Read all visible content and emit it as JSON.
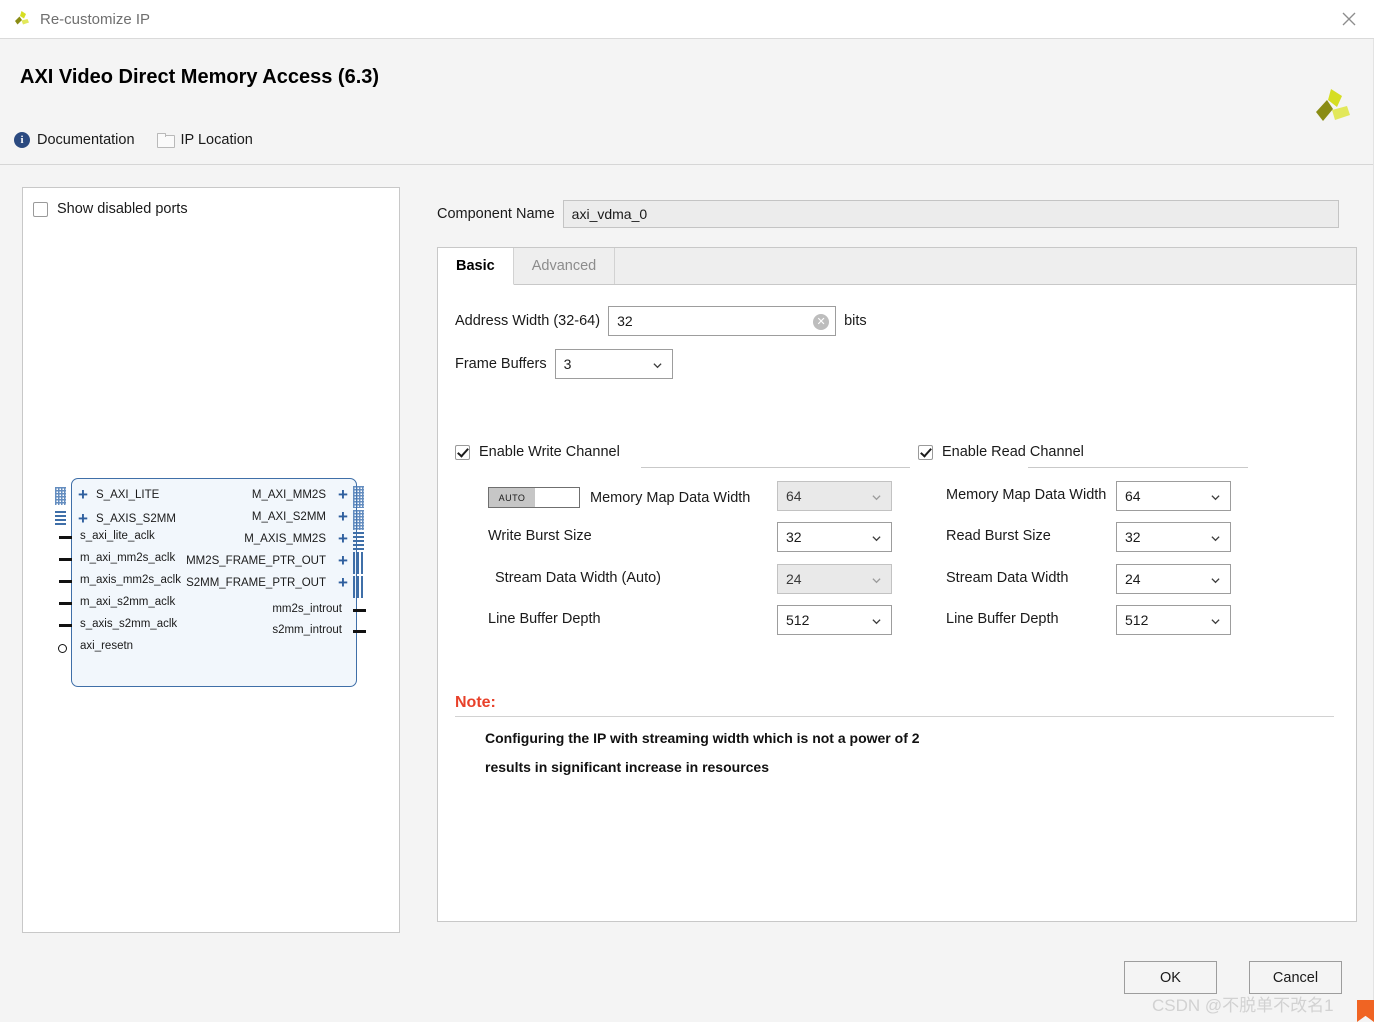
{
  "window": {
    "title": "Re-customize IP",
    "close_icon": "close-icon",
    "app_logo": "xilinx-logo"
  },
  "header": {
    "title": "AXI Video Direct Memory Access (6.3)",
    "logo": "xilinx-logo",
    "links": [
      {
        "label": "Documentation",
        "icon": "info-icon"
      },
      {
        "label": "IP Location",
        "icon": "folder-icon"
      }
    ]
  },
  "left_panel": {
    "show_disabled_ports": {
      "label": "Show disabled ports",
      "checked": false
    },
    "diagram": {
      "left_bus_ports": [
        "S_AXI_LITE",
        "S_AXIS_S2MM"
      ],
      "left_pin_ports": [
        "s_axi_lite_aclk",
        "m_axi_mm2s_aclk",
        "m_axis_mm2s_aclk",
        "m_axi_s2mm_aclk",
        "s_axis_s2mm_aclk",
        "axi_resetn"
      ],
      "right_bus_ports": [
        "M_AXI_MM2S",
        "M_AXI_S2MM",
        "M_AXIS_MM2S",
        "MM2S_FRAME_PTR_OUT",
        "S2MM_FRAME_PTR_OUT"
      ],
      "right_pin_ports": [
        "mm2s_introut",
        "s2mm_introut"
      ]
    }
  },
  "component": {
    "label": "Component Name",
    "value": "axi_vdma_0"
  },
  "tabs": [
    {
      "label": "Basic",
      "active": true
    },
    {
      "label": "Advanced",
      "active": false
    }
  ],
  "basic": {
    "address_width": {
      "label": "Address Width (32-64)",
      "value": "32",
      "units": "bits",
      "clear_icon": "clear-icon"
    },
    "frame_buffers": {
      "label": "Frame Buffers",
      "value": "3"
    },
    "write_channel": {
      "label": "Enable Write Channel",
      "checked": true,
      "auto_toggle": {
        "label": "AUTO",
        "state": "on"
      },
      "fields": [
        {
          "label": "Memory Map Data Width",
          "value": "64",
          "disabled": true
        },
        {
          "label": "Write Burst Size",
          "value": "32",
          "disabled": false
        },
        {
          "label": "Stream Data Width (Auto)",
          "value": "24",
          "disabled": true
        },
        {
          "label": "Line Buffer Depth",
          "value": "512",
          "disabled": false
        }
      ]
    },
    "read_channel": {
      "label": "Enable Read Channel",
      "checked": true,
      "fields": [
        {
          "label": "Memory Map Data Width",
          "value": "64",
          "disabled": false
        },
        {
          "label": "Read Burst Size",
          "value": "32",
          "disabled": false
        },
        {
          "label": "Stream Data Width",
          "value": "24",
          "disabled": false
        },
        {
          "label": "Line Buffer Depth",
          "value": "512",
          "disabled": false
        }
      ]
    },
    "note": {
      "title": "Note:",
      "lines": [
        "Configuring the IP with streaming width which is not a power of 2",
        "results in significant increase in resources"
      ]
    }
  },
  "footer": {
    "ok_label": "OK",
    "cancel_label": "Cancel"
  },
  "watermark": {
    "text": "CSDN @不脱单不改名1"
  },
  "colors": {
    "note_red": "#e8412a",
    "block_border": "#3f6fa8",
    "block_fill": "#f2f7fc",
    "dialog_bg": "#f4f4f4",
    "logo_green": "#d6de23",
    "logo_olive": "#8a8c14"
  }
}
